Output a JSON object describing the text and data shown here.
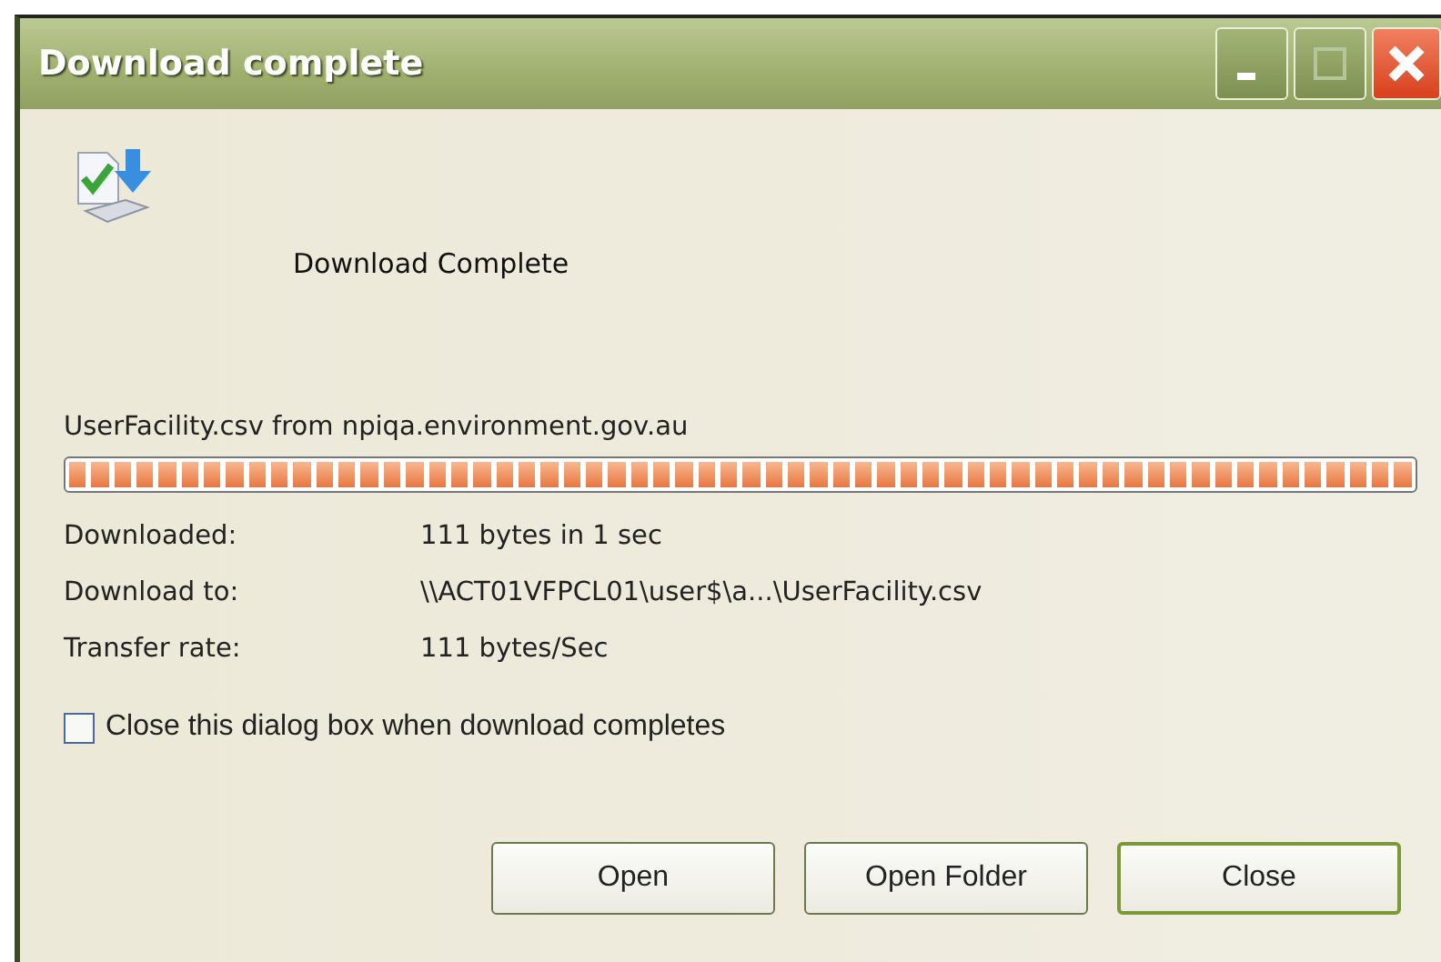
{
  "window": {
    "title": "Download complete"
  },
  "heading": "Download Complete",
  "source": "UserFacility.csv from npiqa.environment.gov.au",
  "progress": {
    "level": 1
  },
  "details": [
    {
      "label": "Downloaded:",
      "value": "111 bytes in 1 sec"
    },
    {
      "label": "Download to:",
      "value": "\\\\ACT01VFPCL01\\user$\\a...\\UserFacility.csv"
    },
    {
      "label": "Transfer rate:",
      "value": "111 bytes/Sec"
    }
  ],
  "close_when_done": {
    "label": "Close this dialog box when download completes",
    "checked": false
  },
  "buttons": [
    {
      "label": "Open",
      "default": false
    },
    {
      "label": "Open Folder",
      "default": false
    },
    {
      "label": "Close",
      "default": true
    }
  ]
}
